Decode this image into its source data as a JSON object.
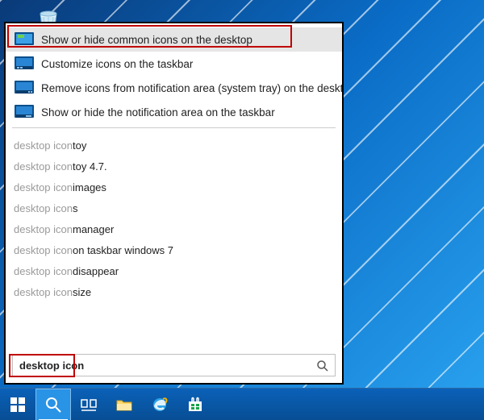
{
  "desktop": {
    "recycle_bin_name": "Recycle Bin"
  },
  "search": {
    "query": "desktop icon",
    "results": [
      {
        "label": "Show or hide common icons on the desktop",
        "selected": true
      },
      {
        "label": "Customize icons on the taskbar",
        "selected": false
      },
      {
        "label": "Remove icons from notification area (system tray) on the desktop",
        "selected": false
      },
      {
        "label": "Show or hide the notification area on the taskbar",
        "selected": false
      }
    ],
    "suggestions": [
      {
        "prefix": "desktop icon ",
        "suffix": "toy"
      },
      {
        "prefix": "desktop icon ",
        "suffix": "toy 4.7."
      },
      {
        "prefix": "desktop icon ",
        "suffix": "images"
      },
      {
        "prefix": "desktop icon",
        "suffix": "s"
      },
      {
        "prefix": "desktop icon ",
        "suffix": "manager"
      },
      {
        "prefix": "desktop icon ",
        "suffix": "on taskbar windows 7"
      },
      {
        "prefix": "desktop icon ",
        "suffix": "disappear"
      },
      {
        "prefix": "desktop icon ",
        "suffix": "size"
      }
    ]
  },
  "taskbar": {
    "items": [
      {
        "name": "start-button"
      },
      {
        "name": "search-button",
        "active": true
      },
      {
        "name": "task-view-button"
      },
      {
        "name": "file-explorer-button"
      },
      {
        "name": "internet-explorer-button"
      },
      {
        "name": "store-button"
      }
    ]
  },
  "colors": {
    "taskbar": "#0a61b8",
    "accent": "#2993e6",
    "annotation": "#c00000"
  }
}
